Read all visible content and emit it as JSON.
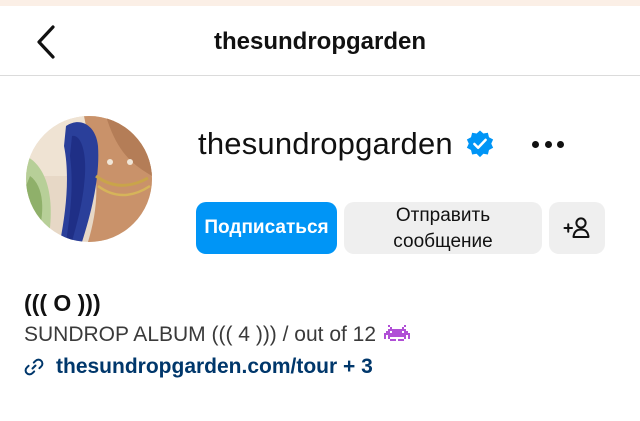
{
  "header": {
    "title": "thesundropgarden"
  },
  "profile": {
    "username": "thesundropgarden",
    "verified": true
  },
  "actions": {
    "follow_label": "Подписаться",
    "message_label": "Отправить сообщение"
  },
  "bio": {
    "name": "((( O )))",
    "text": "SUNDROP ALBUM ((( 4 ))) / out of 12",
    "link": "thesundropgarden.com/tour + 3"
  },
  "icons": {
    "back": "chevron-left-icon",
    "verified": "verified-badge-icon",
    "more": "more-horizontal-icon",
    "add_user": "add-user-icon",
    "link": "link-icon",
    "emoji": "space-invader-icon"
  },
  "colors": {
    "primary": "#0095f6",
    "secondary_button": "#efefef",
    "link": "#00376b",
    "verified": "#0095f6",
    "emoji": "#b04fd6"
  }
}
